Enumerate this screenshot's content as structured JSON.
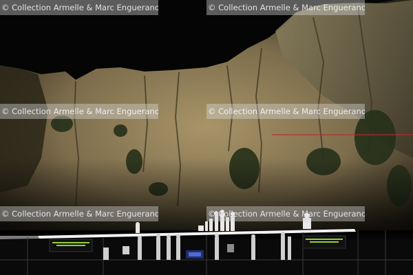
{
  "photo": {
    "watermark_text": "© Collection Armelle & Marc Enguerand",
    "watermark_count": 6,
    "scene": "night outdoor stage in front of floodlit limestone cliff",
    "colors": {
      "sky": "#050505",
      "cliff_light": "#9c8a62",
      "cliff_shadow": "#2b2619",
      "stage_light": "#f2f2f2",
      "surtitle_screen_text": "#b8ff3c",
      "laser_line": "#c0282a"
    }
  }
}
